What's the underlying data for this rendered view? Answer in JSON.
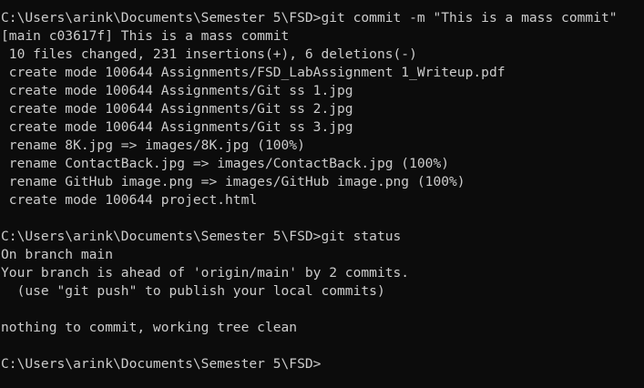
{
  "terminal": {
    "background": "#0c0c0c",
    "foreground": "#cccccc",
    "lines": [
      "C:\\Users\\arink\\Documents\\Semester 5\\FSD>git commit -m \"This is a mass commit\"",
      "[main c03617f] This is a mass commit",
      " 10 files changed, 231 insertions(+), 6 deletions(-)",
      " create mode 100644 Assignments/FSD_LabAssignment 1_Writeup.pdf",
      " create mode 100644 Assignments/Git ss 1.jpg",
      " create mode 100644 Assignments/Git ss 2.jpg",
      " create mode 100644 Assignments/Git ss 3.jpg",
      " rename 8K.jpg => images/8K.jpg (100%)",
      " rename ContactBack.jpg => images/ContactBack.jpg (100%)",
      " rename GitHub image.png => images/GitHub image.png (100%)",
      " create mode 100644 project.html",
      "",
      "C:\\Users\\arink\\Documents\\Semester 5\\FSD>git status",
      "On branch main",
      "Your branch is ahead of 'origin/main' by 2 commits.",
      "  (use \"git push\" to publish your local commits)",
      "",
      "nothing to commit, working tree clean",
      "",
      "C:\\Users\\arink\\Documents\\Semester 5\\FSD>"
    ]
  }
}
